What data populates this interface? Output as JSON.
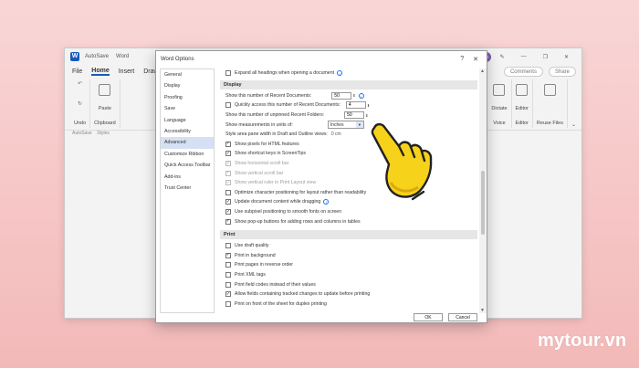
{
  "word": {
    "autosave": "AutoSave",
    "doc_title": "Word",
    "menu": [
      "File",
      "Home",
      "Insert",
      "Draw"
    ],
    "active_menu": "Home",
    "avatar": "NG",
    "comments": "Comments",
    "share": "Share",
    "ribbon_left": [
      {
        "label": "Undo"
      },
      {
        "label": "Clipboard"
      }
    ],
    "paste": "Paste",
    "ribbon_right": [
      {
        "label": "Voice",
        "sub": "Dictate"
      },
      {
        "label": "Editor",
        "sub": "Editor"
      },
      {
        "label": "Reuse Files",
        "sub": "Reuse Files"
      }
    ],
    "status_left": "AutoSave",
    "status_styles": "Styles"
  },
  "dialog": {
    "title": "Word Options",
    "help": "?",
    "close": "✕",
    "categories": [
      "General",
      "Display",
      "Proofing",
      "Save",
      "Language",
      "Accessibility",
      "Advanced",
      "Customize Ribbon",
      "Quick Access Toolbar",
      "Add-ins",
      "Trust Center"
    ],
    "selected_category": "Advanced",
    "top_option": "Expand all headings when opening a document",
    "display": {
      "header": "Display",
      "recent_docs_label": "Show this number of Recent Documents:",
      "recent_docs_value": "50",
      "quick_access_label": "Quickly access this number of Recent Documents:",
      "quick_access_value": "4",
      "unpinned_folders_label": "Show this number of unpinned Recent Folders:",
      "unpinned_folders_value": "50",
      "units_label": "Show measurements in units of:",
      "units_value": "Inches",
      "style_width_label": "Style area pane width in Draft and Outline views:",
      "style_width_value": "0 cm",
      "options": [
        {
          "label": "Show pixels for HTML features",
          "checked": true,
          "disabled": false
        },
        {
          "label": "Show shortcut keys in ScreenTips",
          "checked": true,
          "disabled": false
        },
        {
          "label": "Show horizontal scroll bar",
          "checked": true,
          "disabled": true
        },
        {
          "label": "Show vertical scroll bar",
          "checked": true,
          "disabled": true
        },
        {
          "label": "Show vertical ruler in Print Layout view",
          "checked": true,
          "disabled": true
        },
        {
          "label": "Optimize character positioning for layout rather than readability",
          "checked": false,
          "disabled": false
        },
        {
          "label": "Update document content while dragging",
          "checked": true,
          "disabled": false
        },
        {
          "label": "Use subpixel positioning to smooth fonts on screen",
          "checked": true,
          "disabled": false
        },
        {
          "label": "Show pop-up buttons for adding rows and columns in tables",
          "checked": true,
          "disabled": false
        }
      ]
    },
    "print": {
      "header": "Print",
      "options": [
        {
          "label": "Use draft quality",
          "checked": false
        },
        {
          "label": "Print in background",
          "checked": true
        },
        {
          "label": "Print pages in reverse order",
          "checked": false
        },
        {
          "label": "Print XML tags",
          "checked": false
        },
        {
          "label": "Print field codes instead of their values",
          "checked": false
        },
        {
          "label": "Allow fields containing tracked changes to update before printing",
          "checked": true
        },
        {
          "label": "Print on front of the sheet for duplex printing",
          "checked": false
        }
      ]
    },
    "ok": "OK",
    "cancel": "Cancel"
  },
  "brand": "mytour.vn",
  "colors": {
    "accent": "#185abd",
    "selected": "#d5e1f2",
    "hand": "#f6d21b"
  }
}
